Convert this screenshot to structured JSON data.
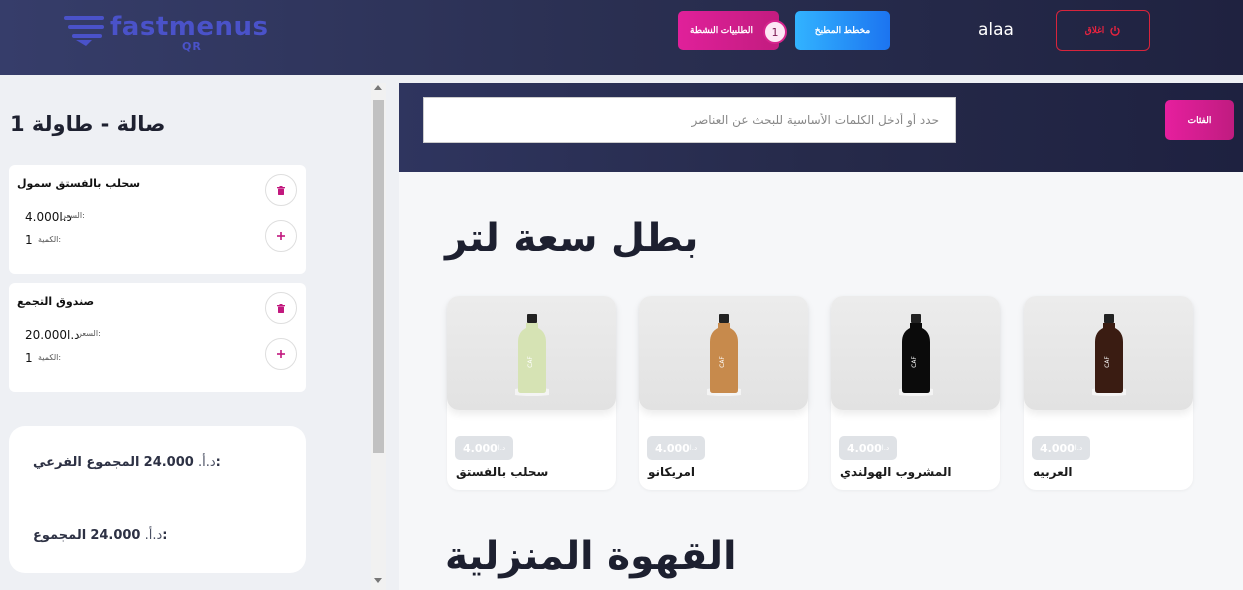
{
  "header": {
    "logo_text": "fastmenus",
    "logo_sub": "QR",
    "active_requests_label": "الطلبيات النشطة",
    "active_requests_count": "1",
    "kitchen_label": "مخطط المطبخ",
    "username": "alaa",
    "logout_label": "اغلاق"
  },
  "sidebar": {
    "table_title": "صالة - طاولة 1",
    "orders": [
      {
        "name": "سحلب بالفستق سمول",
        "price_label": "السعر:",
        "price": "4.000د.ا",
        "qty_label": "الكمية:",
        "qty": "1"
      },
      {
        "name": "صندوق التجمع",
        "price_label": "السعر:",
        "price": "20.000د.ا",
        "qty_label": "الكمية:",
        "qty": "1"
      }
    ],
    "subtotal_label": "المجموع الفرعي:",
    "subtotal_value": "24.000",
    "subtotal_currency": "د.أ.",
    "total_label": "المجموع:",
    "total_value": "24.000",
    "total_currency": "د.أ."
  },
  "search": {
    "placeholder": "حدد أو أدخل الكلمات الأساسية للبحث عن العناصر",
    "categories_label": "الفئات"
  },
  "sections": [
    {
      "title": "بطل سعة لتر",
      "products": [
        {
          "name": "سحلب بالفستق",
          "price": "4.000",
          "currency": "د.ا",
          "liquid": "#d6e3b4"
        },
        {
          "name": "امريكانو",
          "price": "4.000",
          "currency": "د.ا",
          "liquid": "#c78a4c"
        },
        {
          "name": "المشروب الهولندي",
          "price": "4.000",
          "currency": "د.ا",
          "liquid": "#0b0b0b"
        },
        {
          "name": "العربيه",
          "price": "4.000",
          "currency": "د.ا",
          "liquid": "#3a1c12"
        }
      ]
    },
    {
      "title": "القهوة المنزلية"
    }
  ],
  "colors": {
    "accent_pink": "#d6208f",
    "accent_blue": "#1f86f5",
    "logout_red": "#e8233f"
  },
  "icons": {
    "trash": "trash-icon",
    "plus": "plus-icon",
    "power": "power-icon"
  }
}
